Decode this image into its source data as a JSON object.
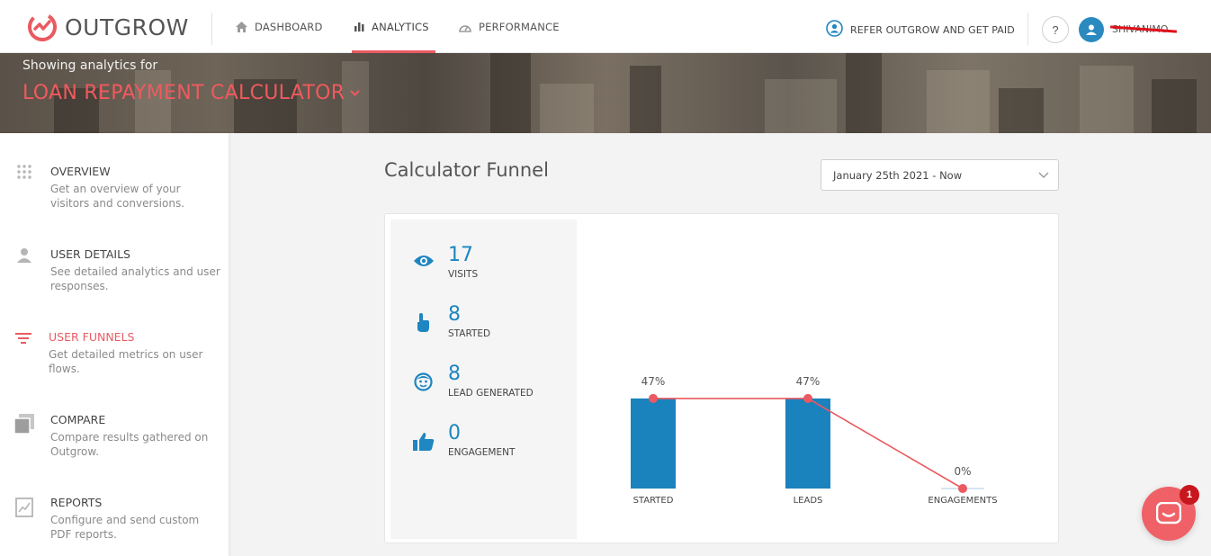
{
  "topnav": {
    "logo_text": "OUTGROW",
    "items": [
      {
        "label": "DASHBOARD",
        "icon": "home-icon"
      },
      {
        "label": "ANALYTICS",
        "icon": "bar-chart-icon",
        "active": true
      },
      {
        "label": "PERFORMANCE",
        "icon": "speedometer-icon"
      }
    ],
    "refer_label": "REFER OUTGROW AND GET PAID",
    "help_label": "?",
    "username": "SHIVANIMO..."
  },
  "banner": {
    "subtitle": "Showing analytics for",
    "title": "LOAN REPAYMENT CALCULATOR"
  },
  "sidebar": {
    "items": [
      {
        "title": "OVERVIEW",
        "desc": "Get an overview of your visitors and conversions.",
        "icon": "grid-dots-icon"
      },
      {
        "title": "USER DETAILS",
        "desc": "See detailed analytics and user responses.",
        "icon": "user-icon"
      },
      {
        "title": "USER FUNNELS",
        "desc": "Get detailed metrics on user flows.",
        "icon": "filter-icon",
        "active": true
      },
      {
        "title": "COMPARE",
        "desc": "Compare results gathered on Outgrow.",
        "icon": "compare-icon"
      },
      {
        "title": "REPORTS",
        "desc": "Configure and send custom PDF reports.",
        "icon": "report-icon"
      }
    ]
  },
  "main": {
    "title": "Calculator Funnel",
    "date_range": "January 25th 2021 - Now"
  },
  "stats": [
    {
      "value": "17",
      "label": "VISITS",
      "icon": "eye-icon"
    },
    {
      "value": "8",
      "label": "STARTED",
      "icon": "pointer-hand-icon"
    },
    {
      "value": "8",
      "label": "LEAD GENERATED",
      "icon": "face-icon"
    },
    {
      "value": "0",
      "label": "ENGAGEMENT",
      "icon": "thumbs-up-icon"
    }
  ],
  "chart_data": {
    "type": "bar",
    "categories": [
      "STARTED",
      "LEADS",
      "ENGAGEMENTS"
    ],
    "values": [
      47,
      47,
      0
    ],
    "data_labels": [
      "47%",
      "47%",
      "0%"
    ],
    "ylim": [
      0,
      100
    ],
    "bar_color": "#1a82bd",
    "line_color": "#ea5a60"
  },
  "chat": {
    "badge": "1"
  },
  "colors": {
    "accent": "#e95b61",
    "primary_blue": "#1e86c0"
  }
}
